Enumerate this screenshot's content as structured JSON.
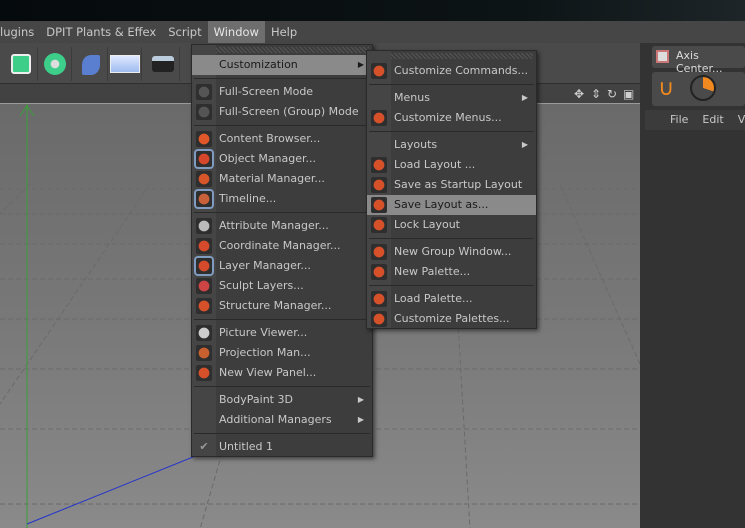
{
  "menubar": [
    "lugins",
    "DPIT Plants & Effex",
    "Script",
    "Window",
    "Help"
  ],
  "right_panel": {
    "axis_center": "Axis Center...",
    "menu": [
      "File",
      "Edit",
      "Vi"
    ]
  },
  "window_menu": [
    {
      "label": "Customization",
      "submenu": true,
      "highlighted": true
    },
    "sep",
    {
      "label": "Full-Screen Mode",
      "icon": "fullscreen-icon",
      "color": "#555"
    },
    {
      "label": "Full-Screen (Group) Mode",
      "icon": "fullscreen-group-icon",
      "color": "#555"
    },
    "sep",
    {
      "label": "Content Browser...",
      "icon": "content-browser-icon",
      "color": "#e0582a"
    },
    {
      "label": "Object Manager...",
      "icon": "object-manager-icon",
      "color": "#d6462a",
      "checked": true
    },
    {
      "label": "Material Manager...",
      "icon": "material-manager-icon",
      "color": "#d6562a"
    },
    {
      "label": "Timeline...",
      "icon": "timeline-icon",
      "color": "#c8603a",
      "checked": true
    },
    "sep",
    {
      "label": "Attribute Manager...",
      "icon": "attribute-manager-icon",
      "color": "#bbb"
    },
    {
      "label": "Coordinate Manager...",
      "icon": "coordinate-manager-icon",
      "color": "#d44a2a"
    },
    {
      "label": "Layer Manager...",
      "icon": "layer-manager-icon",
      "color": "#d44a2a",
      "checked": true
    },
    {
      "label": "Sculpt Layers...",
      "icon": "sculpt-layers-icon",
      "color": "#c44"
    },
    {
      "label": "Structure Manager...",
      "icon": "structure-manager-icon",
      "color": "#d6502a"
    },
    "sep",
    {
      "label": "Picture Viewer...",
      "icon": "picture-viewer-icon",
      "color": "#ccc"
    },
    {
      "label": "Projection Man...",
      "icon": "projection-man-icon",
      "color": "#c86030"
    },
    {
      "label": "New View Panel...",
      "icon": "view-panel-icon",
      "color": "#d6502a"
    },
    "sep",
    {
      "label": "BodyPaint 3D",
      "submenu": true
    },
    {
      "label": "Additional Managers",
      "submenu": true
    },
    "sep",
    {
      "label": "Untitled 1",
      "icon": "checkmark-icon",
      "check": "✔"
    }
  ],
  "customization_menu": [
    {
      "label": "Customize Commands...",
      "icon": "customize-commands-icon",
      "color": "#d6502a"
    },
    "sep",
    {
      "label": "Menus",
      "submenu": true
    },
    {
      "label": "Customize Menus...",
      "icon": "customize-menus-icon",
      "color": "#d6502a"
    },
    "sep",
    {
      "label": "Layouts",
      "submenu": true
    },
    {
      "label": "Load Layout ...",
      "icon": "load-layout-icon",
      "color": "#d6502a"
    },
    {
      "label": "Save as Startup Layout",
      "icon": "save-startup-layout-icon",
      "color": "#d6502a"
    },
    {
      "label": "Save Layout as...",
      "icon": "save-layout-icon",
      "color": "#d6502a",
      "highlighted": true
    },
    {
      "label": "Lock Layout",
      "icon": "lock-layout-icon",
      "color": "#d6502a"
    },
    "sep",
    {
      "label": "New Group Window...",
      "icon": "new-group-window-icon",
      "color": "#d6502a"
    },
    {
      "label": "New Palette...",
      "icon": "new-palette-icon",
      "color": "#d6502a"
    },
    "sep",
    {
      "label": "Load Palette...",
      "icon": "load-palette-icon",
      "color": "#d6502a"
    },
    {
      "label": "Customize Palettes...",
      "icon": "customize-palettes-icon",
      "color": "#d6502a"
    }
  ]
}
